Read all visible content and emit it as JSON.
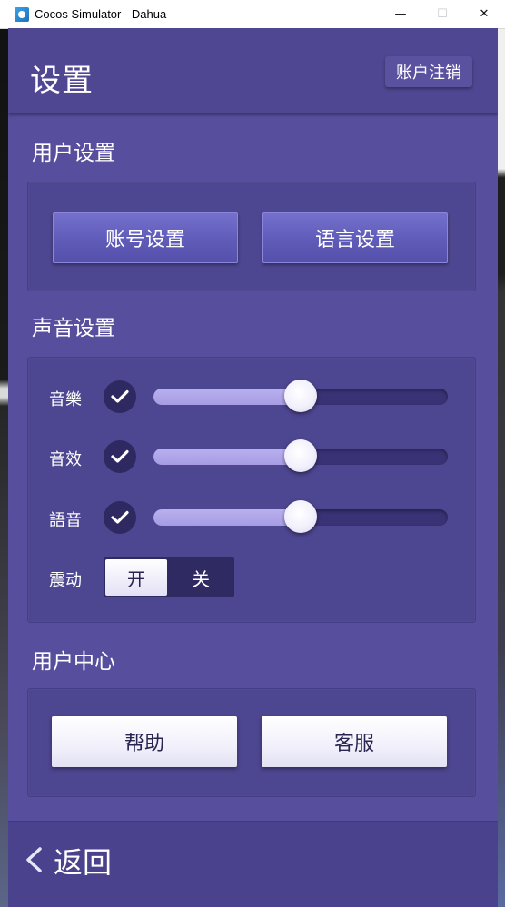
{
  "window": {
    "title": "Cocos Simulator - Dahua",
    "minimize": "—",
    "maximize": "☐",
    "close": "✕"
  },
  "header": {
    "title": "设置",
    "logout_label": "账户注销"
  },
  "user_settings": {
    "title": "用户设置",
    "account_label": "账号设置",
    "language_label": "语言设置"
  },
  "sound_settings": {
    "title": "声音设置",
    "rows": [
      {
        "label": "音樂",
        "checked": true,
        "level": 0.5
      },
      {
        "label": "音效",
        "checked": true,
        "level": 0.5
      },
      {
        "label": "語音",
        "checked": true,
        "level": 0.5
      }
    ],
    "vibration": {
      "label": "震动",
      "on_label": "开",
      "off_label": "关",
      "selected": "开"
    }
  },
  "user_center": {
    "title": "用户中心",
    "help_label": "帮助",
    "service_label": "客服"
  },
  "footer": {
    "back_label": "返回"
  },
  "colors": {
    "background": "#574f9d",
    "panel": "#4d4690",
    "track": "#393275",
    "fill": "#b0a6ea",
    "accent_button": "#6561bd"
  }
}
